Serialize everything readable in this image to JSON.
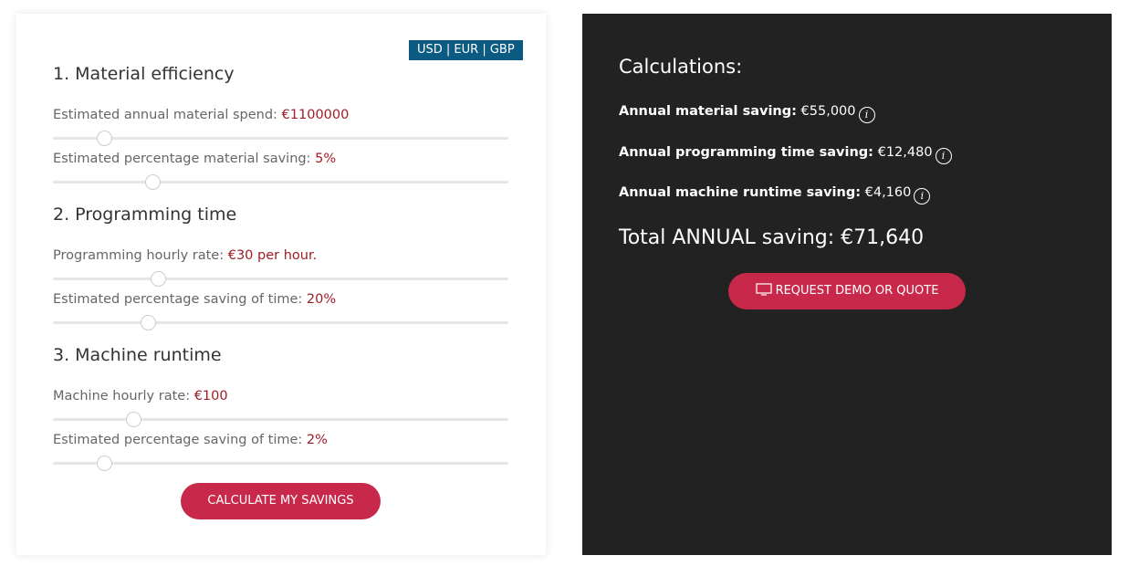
{
  "currency_switch": "USD | EUR | GBP",
  "sections": [
    {
      "title": "1. Material efficiency",
      "fields": [
        {
          "label": "Estimated annual material spend:",
          "value": "€1100000",
          "slider_fraction": 0.112
        },
        {
          "label": "Estimated percentage material saving:",
          "value": "5%",
          "slider_fraction": 0.218
        }
      ]
    },
    {
      "title": "2. Programming time",
      "fields": [
        {
          "label": "Programming hourly rate:",
          "value": "€30 per hour.",
          "slider_fraction": 0.23
        },
        {
          "label": "Estimated percentage saving of time:",
          "value": "20%",
          "slider_fraction": 0.208
        }
      ]
    },
    {
      "title": "3. Machine runtime",
      "fields": [
        {
          "label": "Machine hourly rate:",
          "value": "€100",
          "slider_fraction": 0.176
        },
        {
          "label": "Estimated percentage saving of time:",
          "value": "2%",
          "slider_fraction": 0.112
        }
      ]
    }
  ],
  "calculate_button": "CALCULATE MY SAVINGS",
  "results": {
    "title": "Calculations:",
    "rows": [
      {
        "label": "Annual material saving:",
        "value": "€55,000"
      },
      {
        "label": "Annual programming time saving:",
        "value": "€12,480"
      },
      {
        "label": "Annual machine runtime saving:",
        "value": "€4,160"
      }
    ],
    "total": "Total ANNUAL saving: €71,640",
    "request_button": "REQUEST DEMO OR QUOTE",
    "info_icon": "i"
  },
  "colors": {
    "accent": "#c8294a",
    "currency_bg": "#0b5a82",
    "value": "#a01c24",
    "panel": "#222222"
  }
}
